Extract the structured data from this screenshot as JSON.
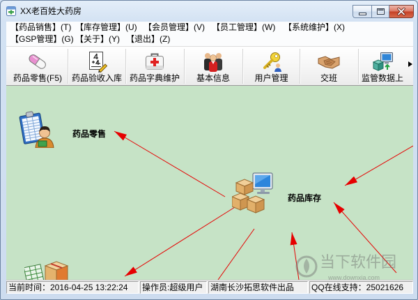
{
  "window": {
    "title": "XX老百姓大药房",
    "app_icon": "pharmacy-app-icon",
    "controls": {
      "minimize_icon": "minimize-icon",
      "maximize_icon": "maximize-icon",
      "close_icon": "close-icon",
      "close_color": "#c94a30"
    }
  },
  "menu": {
    "row1": [
      "【药品销售】(T)",
      "【库存管理】(U)",
      "【会员管理】(V)",
      "【员工管理】(W)",
      "【系统维护】(X)"
    ],
    "row2": [
      "【GSP管理】(G)",
      "【关于】(Y)",
      "【退出】(Z)"
    ]
  },
  "toolbar": {
    "items": [
      {
        "label": "药品零售(F5)",
        "icon": "pill-capsule-icon"
      },
      {
        "label": "药品验收入库",
        "icon": "calculator-notepad-icon"
      },
      {
        "label": "药品字典维护",
        "icon": "first-aid-kit-icon"
      },
      {
        "label": "基本信息",
        "icon": "people-group-icon"
      },
      {
        "label": "用户管理",
        "icon": "user-keys-icon"
      },
      {
        "label": "交班",
        "icon": "handshake-icon"
      },
      {
        "label": "监管数据上",
        "icon": "data-upload-icon"
      }
    ],
    "overflow_icon": "chevron-right-icon"
  },
  "workspace": {
    "background_color": "#c6e3c6",
    "arrow_color": "#e60000",
    "nodes": [
      {
        "label": "药品零售",
        "icon": "retail-clipboard-icon"
      },
      {
        "label": "药品库存",
        "icon": "inventory-computer-icon"
      }
    ],
    "partial_node_icon": "stock-boxes-icon"
  },
  "status_bar": {
    "current_time": "当前时间：2016-04-25 13:22:24",
    "operator": "操作员:超级用户",
    "vendor": "湖南长沙拓思软件出品",
    "support": "QQ在线支持：25021626"
  },
  "watermark": {
    "text": "当下软件园",
    "url": "www.downxia.com",
    "icon": "downxia-logo-icon"
  }
}
